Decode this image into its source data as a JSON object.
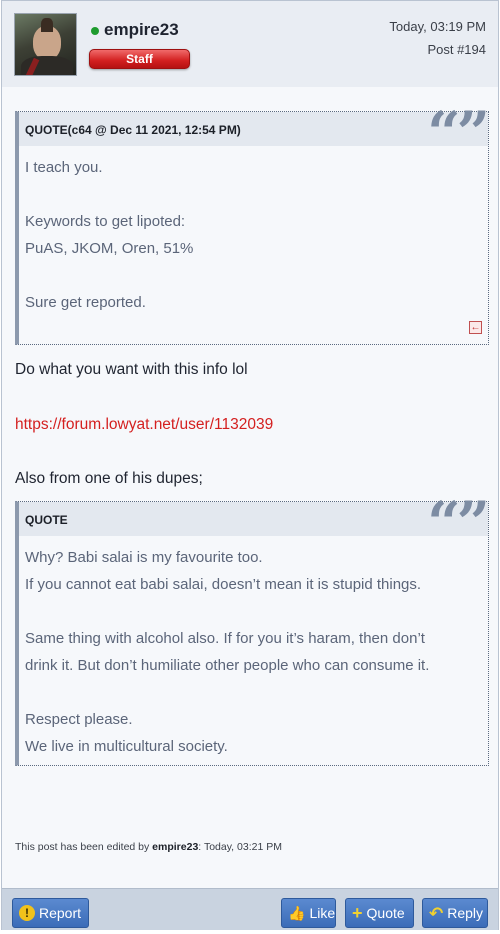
{
  "post": {
    "username": "empire23",
    "badge": "Staff",
    "date": "Today, 03:19 PM",
    "post_number": "Post #194",
    "status_color": "#1e9b2e"
  },
  "quote1": {
    "title": "QUOTE(c64 @ Dec 11 2021, 12:54 PM)",
    "marks": "“”",
    "lines": [
      "I teach you.",
      "",
      "Keywords to get lipoted:",
      "PuAS, JKOM, Oren, 51%",
      "",
      "Sure get reported."
    ],
    "jump_icon": "back-arrow-icon"
  },
  "body": {
    "line1": "Do what you want with this info lol",
    "link": "https://forum.lowyat.net/user/1132039",
    "line2": "Also from one of his dupes;"
  },
  "quote2": {
    "title": "QUOTE",
    "marks": "“”",
    "lines": [
      "Why? Babi salai is my favourite too.",
      "If you cannot eat babi salai, doesn’t mean it is stupid things.",
      "",
      "Same thing with alcohol also. If for you it’s haram, then don’t",
      "drink it. But don’t humiliate other people who can consume it.",
      "",
      "Respect please.",
      "We live in multicultural society."
    ]
  },
  "edit_note": {
    "prefix": "This post has been edited by ",
    "editor": "empire23",
    "suffix": ": Today, 03:21 PM"
  },
  "buttons": {
    "report": "Report",
    "like": "Like",
    "quote": "Quote",
    "reply": "Reply"
  },
  "colors": {
    "link": "#d42020",
    "button": "#3b6cb8",
    "badge": "#d21f1f"
  }
}
